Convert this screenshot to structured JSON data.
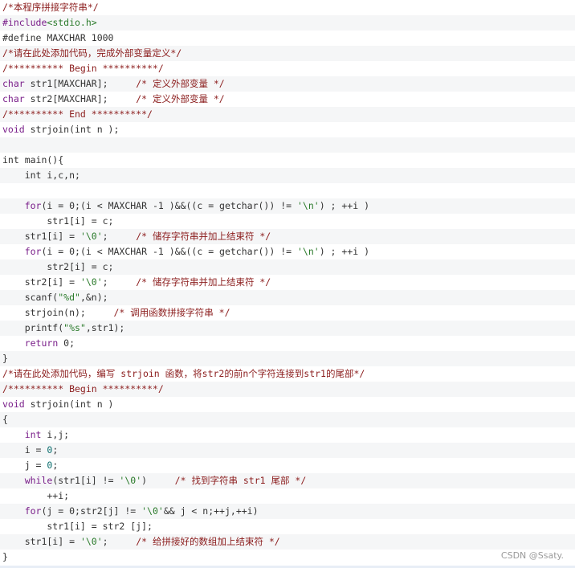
{
  "colors": {
    "comment": "#8b1c1c",
    "keyword": "#7a1f8a",
    "string": "#2a7a2a",
    "number": "#0b6e6e",
    "text": "#333333",
    "alt_row": "#f5f6f7"
  },
  "lines": [
    [
      [
        "c",
        "/*本程序拼接字符串*/"
      ]
    ],
    [
      [
        "p",
        "#include"
      ],
      [
        "s",
        "<stdio.h>"
      ]
    ],
    [
      [
        "t",
        "#define MAXCHAR 1000"
      ]
    ],
    [
      [
        "c",
        "/*请在此处添加代码，完成外部变量定义*/"
      ]
    ],
    [
      [
        "c",
        "/********** Begin **********/"
      ]
    ],
    [
      [
        "k",
        "char"
      ],
      [
        "t",
        " str1[MAXCHAR];     "
      ],
      [
        "c",
        "/* 定义外部变量 */"
      ]
    ],
    [
      [
        "k",
        "char"
      ],
      [
        "t",
        " str2[MAXCHAR];     "
      ],
      [
        "c",
        "/* 定义外部变量 */"
      ]
    ],
    [
      [
        "c",
        "/********** End **********/"
      ]
    ],
    [
      [
        "k",
        "void"
      ],
      [
        "t",
        " strjoin(int n );"
      ]
    ],
    [
      [
        "t",
        ""
      ]
    ],
    [
      [
        "t",
        "int main(){"
      ]
    ],
    [
      [
        "t",
        "    int i,c,n;"
      ]
    ],
    [
      [
        "t",
        ""
      ]
    ],
    [
      [
        "t",
        "    "
      ],
      [
        "k",
        "for"
      ],
      [
        "t",
        "(i = 0;(i < MAXCHAR -1 )&&((c = getchar()) != "
      ],
      [
        "s",
        "'\\n'"
      ],
      [
        "t",
        ") ; ++i )"
      ]
    ],
    [
      [
        "t",
        "        str1[i] = c;"
      ]
    ],
    [
      [
        "t",
        "    str1[i] = "
      ],
      [
        "s",
        "'\\0'"
      ],
      [
        "t",
        ";     "
      ],
      [
        "c",
        "/* 储存字符串并加上结束符 */"
      ]
    ],
    [
      [
        "t",
        "    "
      ],
      [
        "k",
        "for"
      ],
      [
        "t",
        "(i = 0;(i < MAXCHAR -1 )&&((c = getchar()) != "
      ],
      [
        "s",
        "'\\n'"
      ],
      [
        "t",
        ") ; ++i )"
      ]
    ],
    [
      [
        "t",
        "        str2[i] = c;"
      ]
    ],
    [
      [
        "t",
        "    str2[i] = "
      ],
      [
        "s",
        "'\\0'"
      ],
      [
        "t",
        ";     "
      ],
      [
        "c",
        "/* 储存字符串并加上结束符 */"
      ]
    ],
    [
      [
        "t",
        "    scanf("
      ],
      [
        "s",
        "\"%d\""
      ],
      [
        "t",
        ",&n);"
      ]
    ],
    [
      [
        "t",
        "    strjoin(n);     "
      ],
      [
        "c",
        "/* 调用函数拼接字符串 */"
      ]
    ],
    [
      [
        "t",
        "    printf("
      ],
      [
        "s",
        "\"%s\""
      ],
      [
        "t",
        ",str1);"
      ]
    ],
    [
      [
        "t",
        "    "
      ],
      [
        "k",
        "return"
      ],
      [
        "t",
        " 0;"
      ]
    ],
    [
      [
        "t",
        "}"
      ]
    ],
    [
      [
        "c",
        "/*请在此处添加代码，编写 strjoin 函数，将str2的前n个字符连接到str1的尾部*/"
      ]
    ],
    [
      [
        "c",
        "/********** Begin **********/"
      ]
    ],
    [
      [
        "k",
        "void"
      ],
      [
        "t",
        " strjoin(int n )"
      ]
    ],
    [
      [
        "t",
        "{"
      ]
    ],
    [
      [
        "t",
        "    "
      ],
      [
        "k",
        "int"
      ],
      [
        "t",
        " i,j;"
      ]
    ],
    [
      [
        "t",
        "    i = "
      ],
      [
        "n",
        "0"
      ],
      [
        "t",
        ";"
      ]
    ],
    [
      [
        "t",
        "    j = "
      ],
      [
        "n",
        "0"
      ],
      [
        "t",
        ";"
      ]
    ],
    [
      [
        "t",
        "    "
      ],
      [
        "k",
        "while"
      ],
      [
        "t",
        "(str1[i] != "
      ],
      [
        "s",
        "'\\0'"
      ],
      [
        "t",
        ")     "
      ],
      [
        "c",
        "/* 找到字符串 str1 尾部 */"
      ]
    ],
    [
      [
        "t",
        "        ++i;"
      ]
    ],
    [
      [
        "t",
        "    "
      ],
      [
        "k",
        "for"
      ],
      [
        "t",
        "(j = 0;str2[j] != "
      ],
      [
        "s",
        "'\\0'"
      ],
      [
        "t",
        "&& j < n;++j,++i)"
      ]
    ],
    [
      [
        "t",
        "        str1[i] = str2 [j];"
      ]
    ],
    [
      [
        "t",
        "    str1[i] = "
      ],
      [
        "s",
        "'\\0'"
      ],
      [
        "t",
        ";     "
      ],
      [
        "c",
        "/* 给拼接好的数组加上结束符 */"
      ]
    ],
    [
      [
        "t",
        "}"
      ]
    ]
  ],
  "watermark": "CSDN @Ssaty."
}
